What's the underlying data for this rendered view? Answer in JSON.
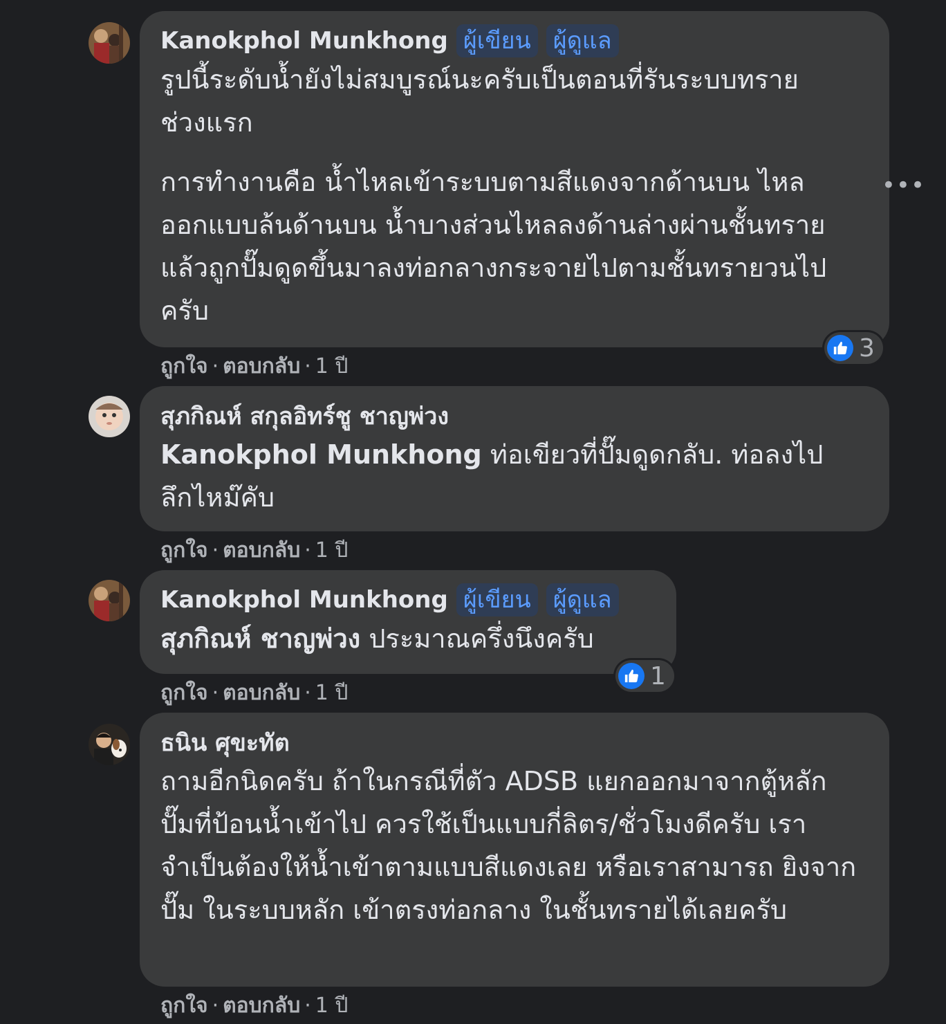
{
  "comments": [
    {
      "author": "Kanokphol Munkhong",
      "badges": [
        "ผู้เขียน",
        "ผู้ดูแล"
      ],
      "paragraphs": [
        "รูปนี้ระดับน้ำยังไม่สมบูรณ์นะครับเป็นตอนที่รันระบบทรายช่วงแรก",
        "การทำงานคือ น้ำไหลเข้าระบบตามสีแดงจากด้านบน ไหลออกแบบล้นด้านบน น้ำบางส่วนไหลลงด้านล่างผ่านชั้นทราย แล้วถูกปั๊มดูดขึ้นมาลงท่อกลางกระจายไปตามชั้นทรายวนไปครับ"
      ],
      "like_label": "ถูกใจ",
      "reply_label": "ตอบกลับ",
      "time": "1 ปี",
      "reactions": "3"
    },
    {
      "author": "สุภกิณห์ สกุลอิทร์ชู ชาญพ่วง",
      "mention": "Kanokphol Munkhong",
      "text": " ท่อเขียวที่ปั๊มดูดกลับ. ท่อลงไปลึกไหม๊คับ",
      "like_label": "ถูกใจ",
      "reply_label": "ตอบกลับ",
      "time": "1 ปี"
    },
    {
      "author": "Kanokphol Munkhong",
      "badges": [
        "ผู้เขียน",
        "ผู้ดูแล"
      ],
      "mention": "สุภกิณห์ ชาญพ่วง",
      "text": " ประมาณครึ่งนึงครับ",
      "like_label": "ถูกใจ",
      "reply_label": "ตอบกลับ",
      "time": "1 ปี",
      "reactions": "1"
    },
    {
      "author": "ธนิน ศุขะทัต",
      "text": "ถามอีกนิดครับ ถ้าในกรณีที่ตัว ADSB แยกออกมาจากตู้หลัก ปั๊มที่ป้อนน้ำเข้าไป ควรใช้เป็นแบบกี่ลิตร/ชั่วโมงดีครับ เราจำเป็นต้องให้น้ำเข้าตามแบบสีแดงเลย หรือเราสามารถ ยิงจากปั๊ม ในระบบหลัก เข้าตรงท่อกลาง ในชั้นทรายได้เลยครับ",
      "like_label": "ถูกใจ",
      "reply_label": "ตอบกลับ",
      "time": "1 ปี"
    }
  ],
  "more_menu": "•••",
  "separator": "·",
  "colors": {
    "background": "#1e1f22",
    "bubble": "#3a3b3c",
    "badge_text": "#5b9cff",
    "like_blue": "#1877f2"
  }
}
